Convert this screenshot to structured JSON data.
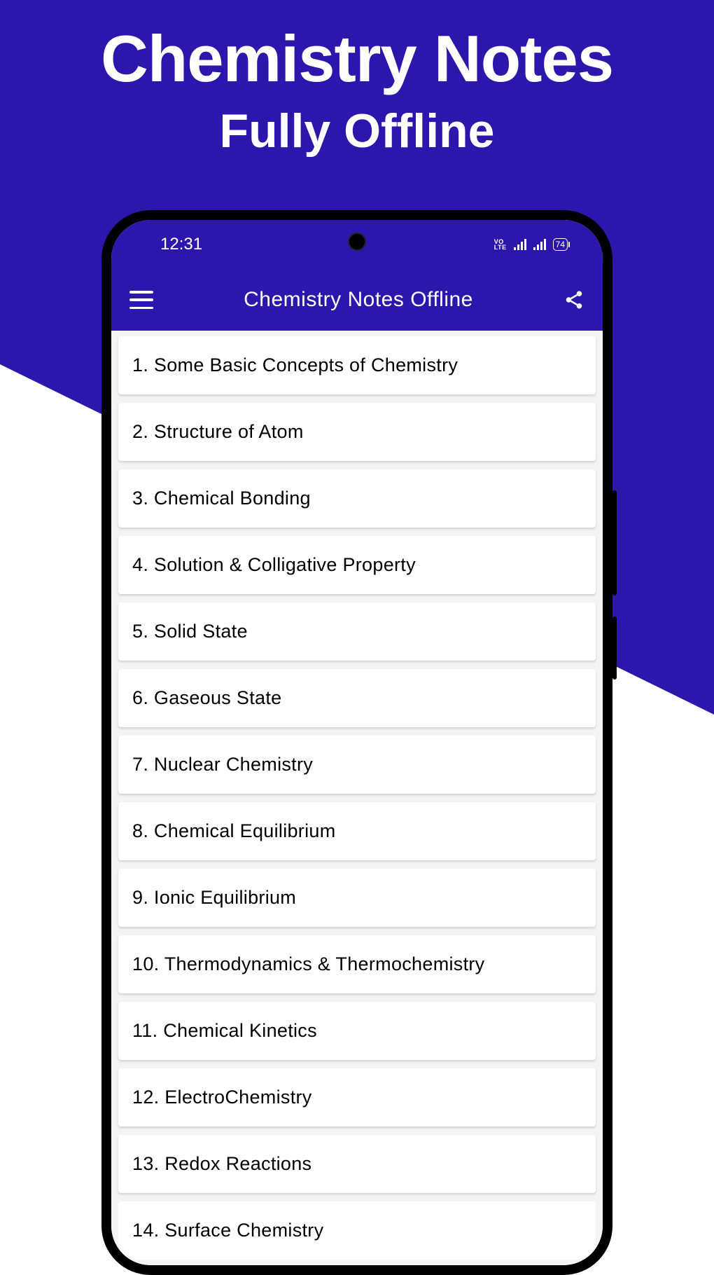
{
  "promo": {
    "title": "Chemistry Notes",
    "subtitle": "Fully Offline"
  },
  "statusbar": {
    "time": "12:31",
    "volte": "VO\nLTE",
    "battery": "74"
  },
  "appbar": {
    "title": "Chemistry Notes Offline"
  },
  "chapters": [
    {
      "label": "1. Some Basic Concepts of Chemistry"
    },
    {
      "label": "2. Structure of Atom"
    },
    {
      "label": "3. Chemical Bonding"
    },
    {
      "label": "4. Solution & Colligative Property"
    },
    {
      "label": "5. Solid State"
    },
    {
      "label": "6. Gaseous State"
    },
    {
      "label": "7. Nuclear Chemistry"
    },
    {
      "label": "8. Chemical Equilibrium"
    },
    {
      "label": "9. Ionic Equilibrium"
    },
    {
      "label": "10. Thermodynamics & Thermochemistry"
    },
    {
      "label": "11. Chemical Kinetics"
    },
    {
      "label": "12. ElectroChemistry"
    },
    {
      "label": "13. Redox Reactions"
    },
    {
      "label": "14. Surface Chemistry"
    }
  ]
}
